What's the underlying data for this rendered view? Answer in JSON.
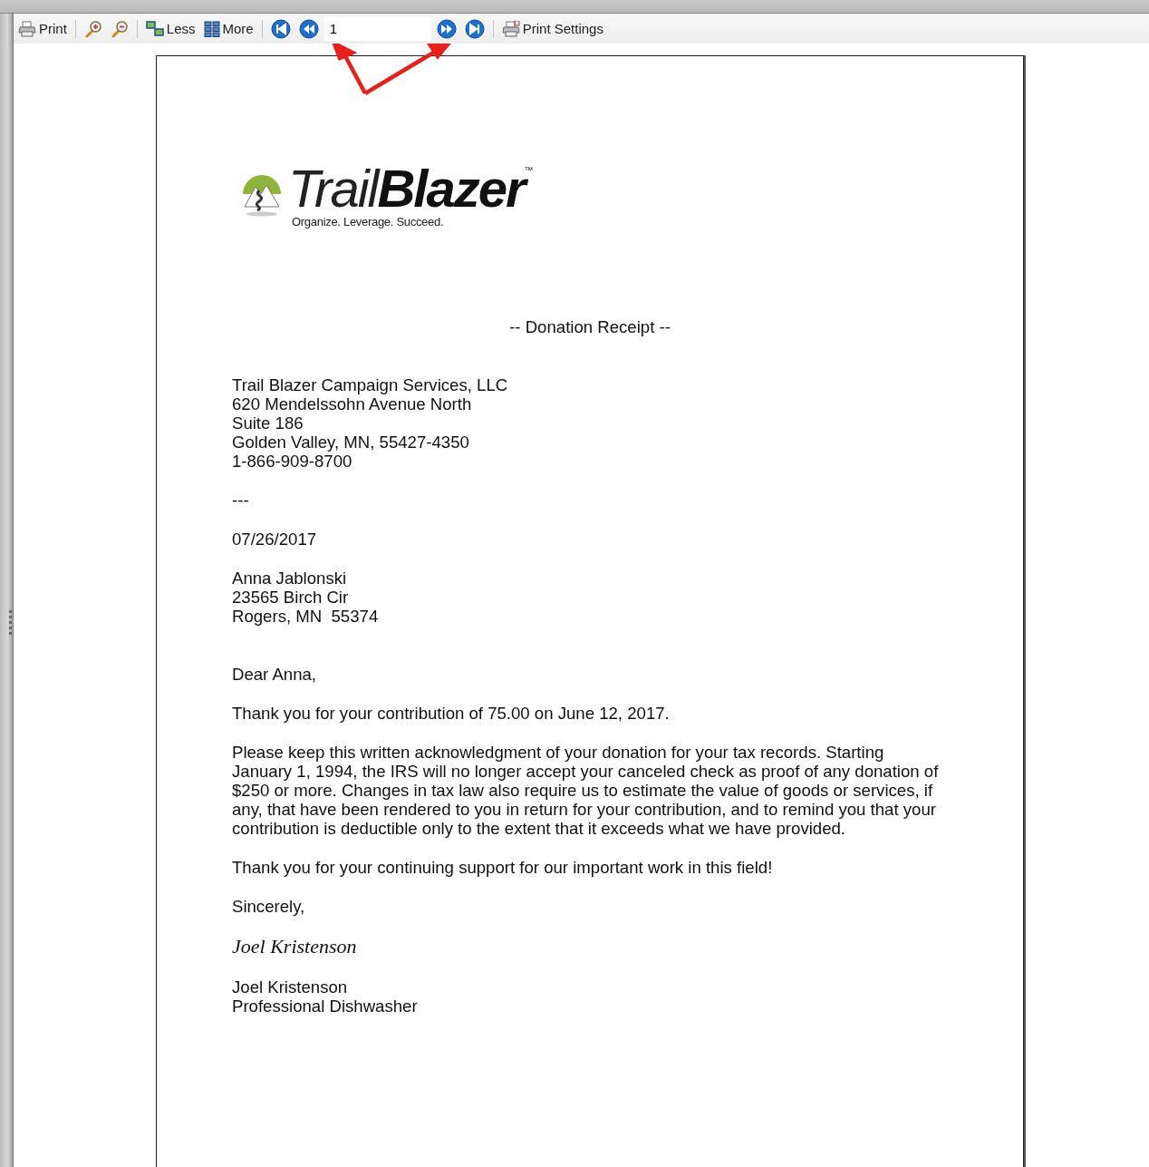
{
  "toolbar": [
    {
      "kind": "print",
      "label": "Print"
    },
    {
      "kind": "separator"
    },
    {
      "kind": "zoom-in"
    },
    {
      "kind": "zoom-out"
    },
    {
      "kind": "separator"
    },
    {
      "kind": "less",
      "label": "Less"
    },
    {
      "kind": "more",
      "label": "More"
    },
    {
      "kind": "separator"
    },
    {
      "kind": "first"
    },
    {
      "kind": "previous"
    },
    {
      "kind": "field",
      "value": "1"
    },
    {
      "kind": "next"
    },
    {
      "kind": "last"
    },
    {
      "kind": "separator"
    },
    {
      "kind": "print-settings",
      "label": "Print Settings"
    }
  ],
  "logo": {
    "word_light": "Trail",
    "word_bold": "Blazer",
    "trademark": "™",
    "tagline": "Organize. Leverage. Succeed."
  },
  "document": {
    "title": "-- Donation Receipt --",
    "blocks": [
      {
        "kind": "address",
        "lines": [
          "Trail Blazer Campaign Services, LLC",
          "620 Mendelssohn Avenue North",
          "Suite 186",
          "Golden Valley, MN, 55427-4350",
          "1-866-909-8700"
        ]
      },
      {
        "kind": "text",
        "lines": [
          "---"
        ]
      },
      {
        "kind": "text",
        "lines": [
          "07/26/2017"
        ]
      },
      {
        "kind": "address",
        "lines": [
          "Anna Jablonski",
          "23565 Birch Cir",
          "Rogers, MN  55374"
        ]
      },
      {
        "kind": "salutation",
        "lines": [
          "Dear Anna,"
        ]
      },
      {
        "kind": "text",
        "lines": [
          "Thank you for your contribution of 75.00 on June 12, 2017."
        ]
      },
      {
        "kind": "text",
        "lines": [
          "Please keep this written acknowledgment of your donation for your tax records. Starting",
          "January 1, 1994, the IRS will no longer accept your canceled check as proof of any donation of",
          "$250 or more. Changes in tax law also require us to estimate the value of goods or services, if",
          "any, that have been rendered to you in return for your contribution, and to remind you that your",
          "contribution is deductible only to the extent that it exceeds what we have provided."
        ]
      },
      {
        "kind": "text",
        "lines": [
          "Thank you for your continuing support for our important work in this field!"
        ]
      },
      {
        "kind": "text",
        "lines": [
          "Sincerely,"
        ]
      },
      {
        "kind": "signature",
        "lines": [
          "Joel Kristenson"
        ]
      },
      {
        "kind": "text",
        "lines": [
          "Joel Kristenson",
          "Professional Dishwasher"
        ]
      }
    ]
  }
}
